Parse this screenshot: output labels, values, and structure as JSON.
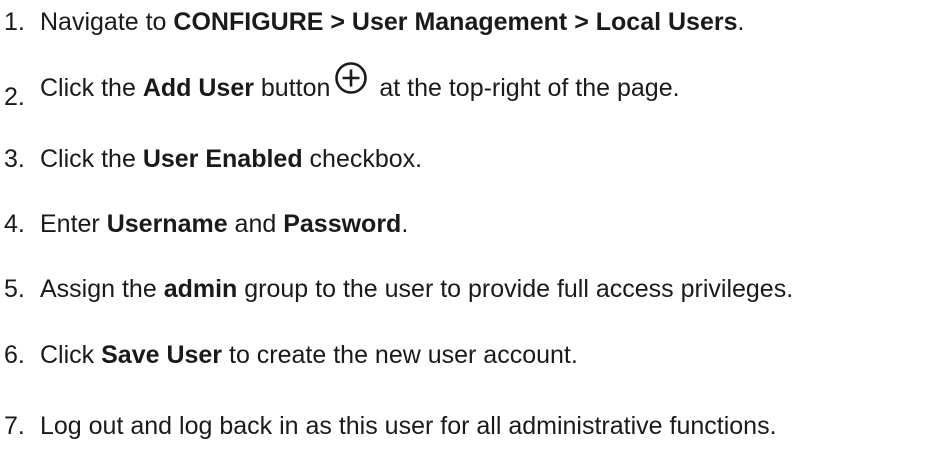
{
  "steps": [
    {
      "number": "1.",
      "parts": [
        "Navigate to ",
        "CONFIGURE > User Management > Local Users",
        "."
      ]
    },
    {
      "number": "2.",
      "parts": [
        "Click the ",
        "Add User",
        " button",
        " at the top-right of the page."
      ],
      "icon": "add-circle-icon"
    },
    {
      "number": "3.",
      "parts": [
        "Click the ",
        "User Enabled",
        " checkbox."
      ]
    },
    {
      "number": "4.",
      "parts": [
        "Enter ",
        "Username",
        " and ",
        "Password",
        "."
      ]
    },
    {
      "number": "5.",
      "parts": [
        "Assign the ",
        "admin",
        " group to the user to provide full access privileges."
      ]
    },
    {
      "number": "6.",
      "parts": [
        "Click ",
        "Save User",
        " to create the new user account."
      ]
    },
    {
      "number": "7.",
      "parts": [
        "Log out and log back in as this user for all administrative functions."
      ]
    }
  ]
}
